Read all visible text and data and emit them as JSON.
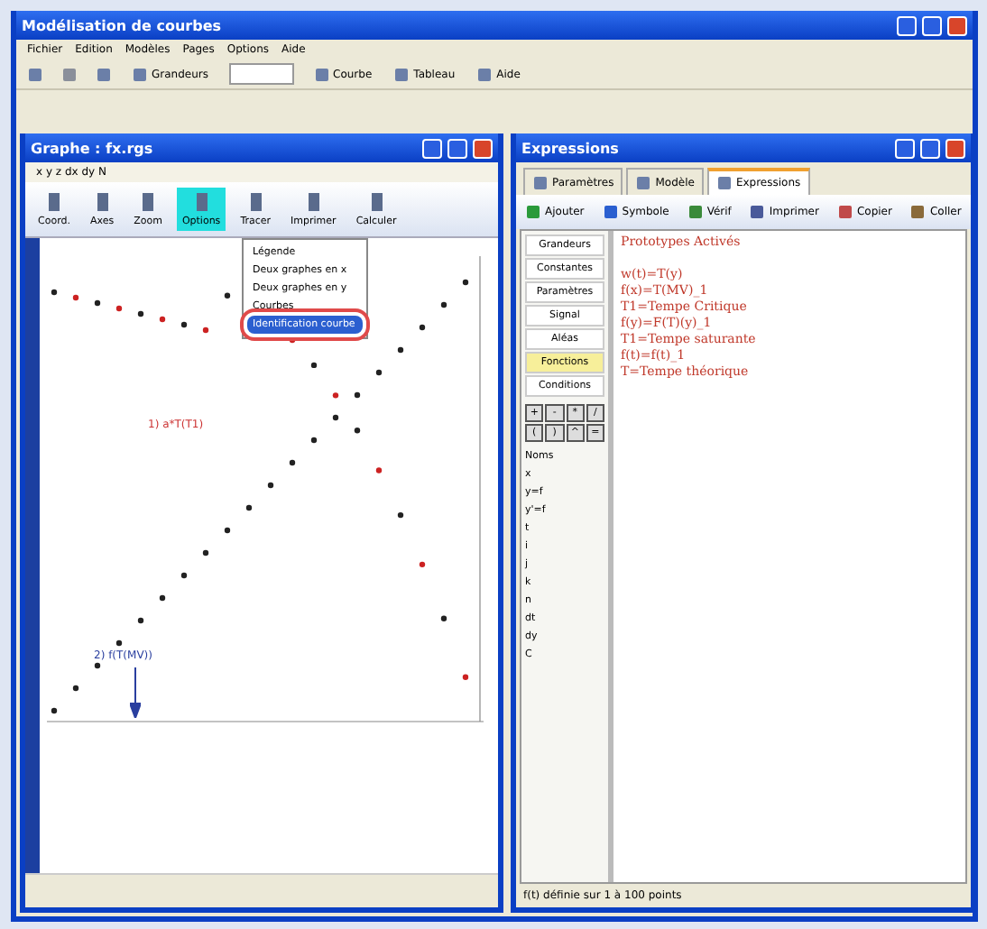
{
  "window": {
    "title": "Modélisation de courbes"
  },
  "menu": [
    "Fichier",
    "Edition",
    "Modèles",
    "Pages",
    "Options",
    "Aide"
  ],
  "toolbar": [
    {
      "label": "Grandeurs",
      "kind": "button"
    },
    {
      "kind": "field"
    },
    {
      "label": "Courbe",
      "kind": "button"
    },
    {
      "label": "Tableau",
      "kind": "button"
    },
    {
      "label": "Aide",
      "kind": "button"
    }
  ],
  "graph": {
    "title": "Graphe : fx.rgs",
    "mini_toolbar": "x y z dx dy N",
    "tools": [
      {
        "label": "Coord.",
        "selected": false
      },
      {
        "label": "Axes",
        "selected": false
      },
      {
        "label": "Zoom",
        "selected": false
      },
      {
        "label": "Options",
        "selected": true
      },
      {
        "label": "Tracer",
        "selected": false
      },
      {
        "label": "Imprimer",
        "selected": false
      },
      {
        "label": "Calculer",
        "selected": false
      }
    ],
    "dropdown": [
      {
        "label": "Légende",
        "selected": false
      },
      {
        "label": "Deux graphes en x",
        "selected": false
      },
      {
        "label": "Deux graphes en y",
        "selected": false
      },
      {
        "label": "Courbes",
        "selected": false
      },
      {
        "label": "Identification courbe",
        "selected": true
      }
    ],
    "annotations": [
      {
        "text": "1) a*T(T1)",
        "kind": "red"
      },
      {
        "text": "2) f(T(MV))",
        "kind": "blue"
      }
    ]
  },
  "expressions": {
    "title": "Expressions",
    "tabs": [
      {
        "label": "Paramètres",
        "selected": false
      },
      {
        "label": "Modèle",
        "selected": false
      },
      {
        "label": "Expressions",
        "selected": true
      }
    ],
    "tools": [
      "Ajouter",
      "Symbole",
      "Vérif",
      "Imprimer",
      "Copier",
      "Coller"
    ],
    "categories": [
      {
        "label": "Grandeurs",
        "selected": false
      },
      {
        "label": "Constantes",
        "selected": false
      },
      {
        "label": "Paramètres",
        "selected": false
      },
      {
        "label": "Signal",
        "selected": false
      },
      {
        "label": "Aléas",
        "selected": false
      },
      {
        "label": "Fonctions",
        "selected": true
      },
      {
        "label": "Conditions",
        "selected": false
      }
    ],
    "keys": [
      "+",
      "-",
      "*",
      "/",
      "(",
      ")",
      "^",
      "="
    ],
    "functions_title": "Noms",
    "functions": [
      "x",
      "y=f",
      "y'=f",
      "t",
      "i",
      "j",
      "k",
      "n",
      "dt",
      "dy",
      "C"
    ],
    "code": [
      "Prototypes Activés",
      "w(t)=T(y)",
      "f(x)=T(MV)_1",
      "T1=Tempe Critique",
      "f(y)=F(T)(y)_1",
      "T1=Tempe saturante",
      "f(t)=f(t)_1",
      "T=Tempe théorique"
    ],
    "status": "f(t) définie sur 1 à 100 points"
  }
}
